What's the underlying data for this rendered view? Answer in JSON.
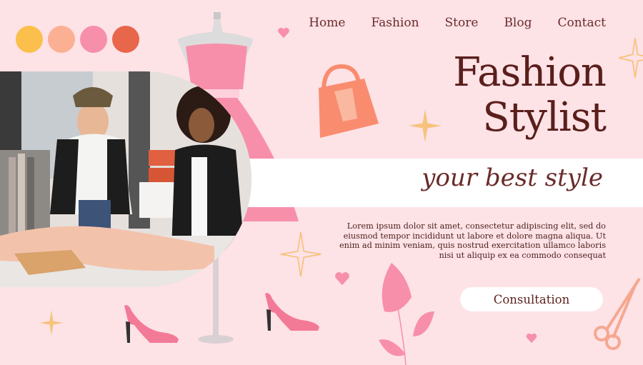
{
  "palette": [
    "#fbc04b",
    "#fbb093",
    "#f78fab",
    "#e8664a"
  ],
  "nav": {
    "items": [
      {
        "label": "Home"
      },
      {
        "label": "Fashion"
      },
      {
        "label": "Store"
      },
      {
        "label": "Blog"
      },
      {
        "label": "Contact"
      }
    ]
  },
  "hero": {
    "title_line1": "Fashion",
    "title_line2": "Stylist",
    "tagline": "your best style",
    "description": "Lorem ipsum dolor sit amet, consectetur adipiscing elit, sed do eiusmod tempor incididunt ut labore et dolore magna aliqua. Ut enim ad minim veniam, quis nostrud exercitation ullamco laboris nisi ut aliquip ex ea commodo consequat",
    "cta_label": "Consultation"
  },
  "colors": {
    "background": "#fde2e6",
    "title": "#5a1f1b",
    "dress": "#f78fab",
    "bag": "#f98c6f",
    "sparkle": "#f6c27c"
  },
  "icons": [
    "dress-form-icon",
    "handbag-icon",
    "sparkle-icon",
    "heart-icon",
    "high-heel-icon",
    "scissors-icon",
    "leaf-branch-icon"
  ]
}
